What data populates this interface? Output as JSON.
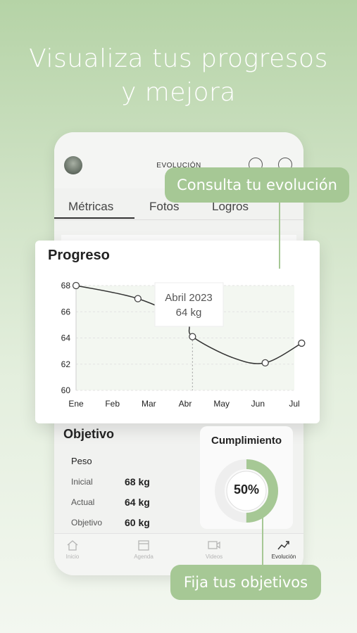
{
  "headline": {
    "line1": "Visualiza  tus progresos",
    "line2": "y mejora"
  },
  "app": {
    "header_title": "EVOLUCIÓN",
    "tabs": [
      {
        "label": "Métricas",
        "active": true
      },
      {
        "label": "Fotos",
        "active": false
      },
      {
        "label": "Logros",
        "active": false
      }
    ]
  },
  "chart_data": {
    "type": "line",
    "title": "Progreso",
    "categories": [
      "Ene",
      "Feb",
      "Mar",
      "Abr",
      "May",
      "Jun",
      "Jul"
    ],
    "x": [
      0,
      1.7,
      3,
      3.2,
      4.3,
      5.2,
      6.2
    ],
    "values": [
      68,
      67,
      65.3,
      64.1,
      62.5,
      62.1,
      63.6
    ],
    "markers": [
      0,
      1,
      3,
      5,
      6
    ],
    "yticks": [
      68,
      66,
      64,
      62,
      60
    ],
    "ylim": [
      60,
      68
    ],
    "tooltip": {
      "line1": "Abril 2023",
      "line2": "64 kg"
    },
    "line_color": "#333333",
    "grid": true
  },
  "objetivo": {
    "title": "Objetivo",
    "subtitle": "Peso",
    "rows": [
      {
        "label": "Inicial",
        "value": "68 kg"
      },
      {
        "label": "Actual",
        "value": "64 kg"
      },
      {
        "label": "Objetivo",
        "value": "60 kg"
      }
    ]
  },
  "cumplimiento": {
    "title": "Cumplimiento",
    "value_text": "50%",
    "fraction": 0.5,
    "color": "#a6c895"
  },
  "nav": {
    "items": [
      {
        "label": "Inicio",
        "icon": "home-icon"
      },
      {
        "label": "Agenda",
        "icon": "calendar-icon"
      },
      {
        "label": "Videos",
        "icon": "video-icon"
      },
      {
        "label": "Evolución",
        "icon": "chart-icon"
      }
    ]
  },
  "callouts": {
    "top": "Consulta tu evolución",
    "bottom": "Fija tus objetivos"
  },
  "colors": {
    "accent": "#a6c895"
  }
}
